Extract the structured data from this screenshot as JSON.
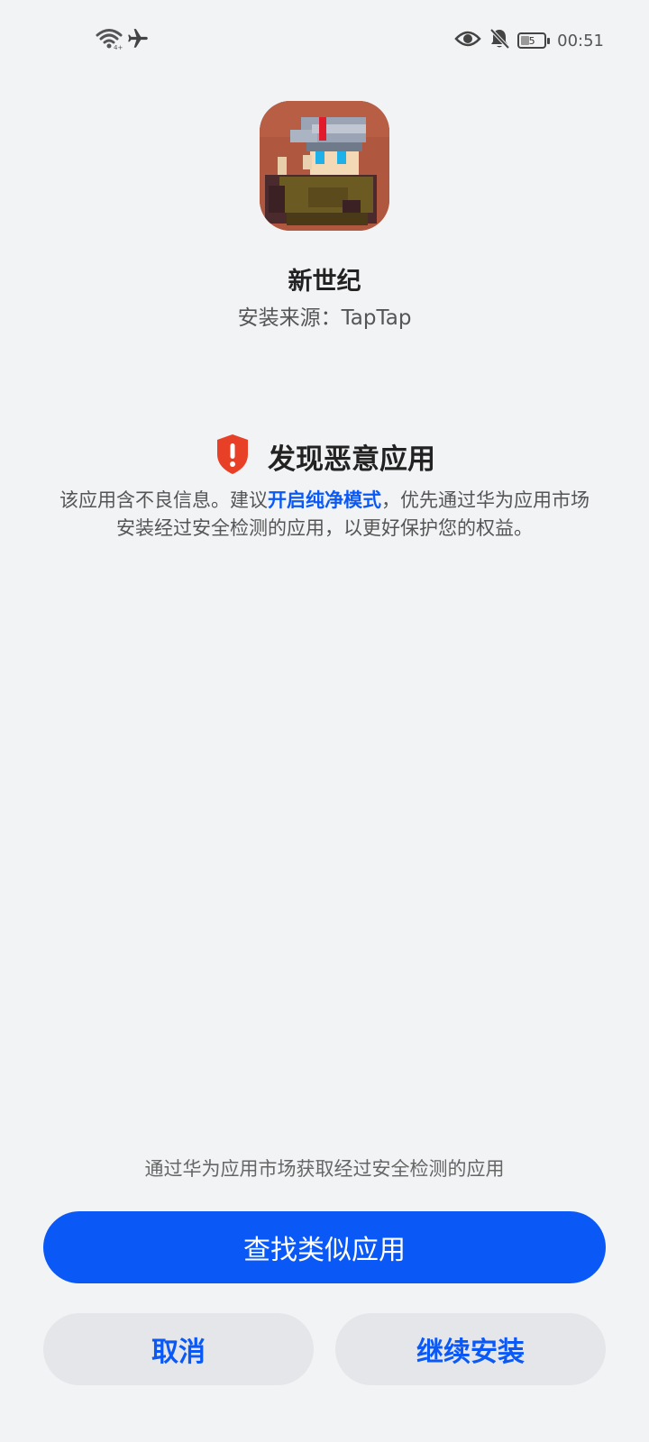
{
  "status_bar": {
    "time": "00:51",
    "battery_level": "5",
    "icons": [
      "wifi-icon",
      "airplane-mode-icon",
      "eye-comfort-icon",
      "mute-bell-icon",
      "battery-icon"
    ]
  },
  "app": {
    "name": "新世纪",
    "source_label": "安装来源：TapTap",
    "icon": "pixel-character-app-icon"
  },
  "warning": {
    "icon": "shield-alert-icon",
    "icon_color": "#e84026",
    "title": "发现恶意应用",
    "desc_before": "该应用含不良信息。建议",
    "desc_link": "开启纯净模式",
    "desc_after": "，优先通过华为应用市场安装经过安全检测的应用，以更好保护您的权益。"
  },
  "footer": {
    "hint": "通过华为应用市场获取经过安全检测的应用",
    "find_similar_label": "查找类似应用",
    "cancel_label": "取消",
    "continue_label": "继续安装"
  },
  "colors": {
    "accent": "#0a59f7",
    "background": "#f1f3f5",
    "secondary_button": "#e4e6e9"
  }
}
